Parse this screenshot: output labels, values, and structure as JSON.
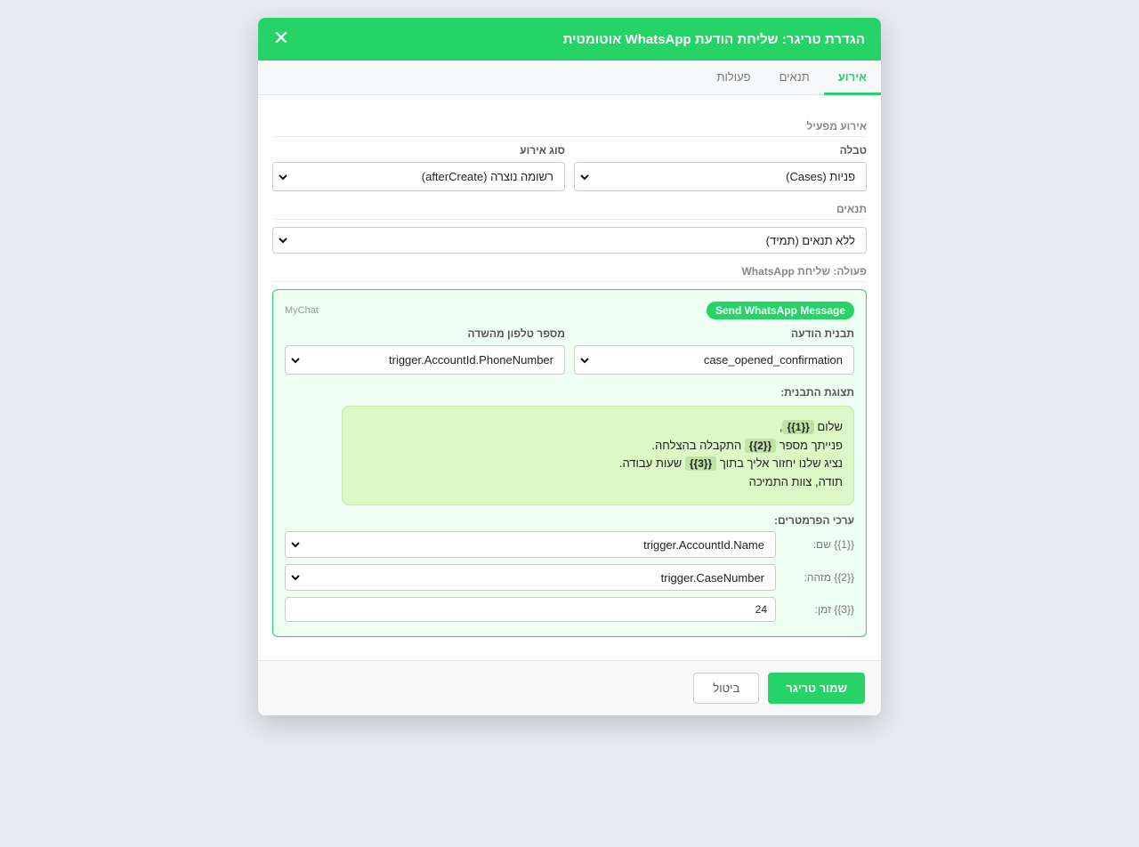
{
  "modal": {
    "title": "הגדרת טריגר: שליחת הודעת WhatsApp אוטומטית",
    "close_symbol": "✕"
  },
  "tabs": [
    {
      "label": "אירוע",
      "active": true
    },
    {
      "label": "תנאים",
      "active": false
    },
    {
      "label": "פעולות",
      "active": false
    }
  ],
  "event_section": {
    "title": "אירוע מפעיל",
    "table_label": "טבלה",
    "table_value": "פניות (Cases)",
    "event_type_label": "סוג אירוע",
    "event_type_value": "רשומה נוצרה (afterCreate)"
  },
  "conditions_section": {
    "title": "תנאים",
    "value": "ללא תנאים (תמיד)"
  },
  "action_section": {
    "title": "פעולה: שליחת WhatsApp",
    "badge": "Send WhatsApp Message ",
    "brand": "MyChat",
    "template_label": "תבנית הודעה",
    "template_value": "case_opened_confirmation",
    "phone_label": "מספר טלפון מהשדה",
    "phone_value": "trigger.AccountId.PhoneNumber",
    "preview_label": "תצוגת התבנית:",
    "preview": {
      "line1_pre": "שלום ",
      "var1": "{{1}}",
      "line1_post": ",",
      "line2_pre": "פנייתך מספר ",
      "var2": "{{2}}",
      "line2_post": " התקבלה בהצלחה.",
      "line3_pre": "נציג שלנו יחזור אליך בתוך ",
      "var3": "{{3}}",
      "line3_post": " שעות עבודה.",
      "line4": "תודה, צוות התמיכה"
    },
    "params_label": "ערכי הפרמטרים:",
    "params": [
      {
        "label": "{{1}} שם:",
        "value": "trigger.AccountId.Name",
        "type": "select"
      },
      {
        "label": "{{2}} מזהה:",
        "value": "trigger.CaseNumber",
        "type": "select"
      },
      {
        "label": "{{3}} זמן:",
        "value": "24",
        "type": "input"
      }
    ]
  },
  "footer": {
    "save_label": "שמור טריגר",
    "cancel_label": "ביטול"
  },
  "colors": {
    "accent": "#25d366",
    "bubble": "#dcf8c6",
    "background": "#e7ebef"
  }
}
